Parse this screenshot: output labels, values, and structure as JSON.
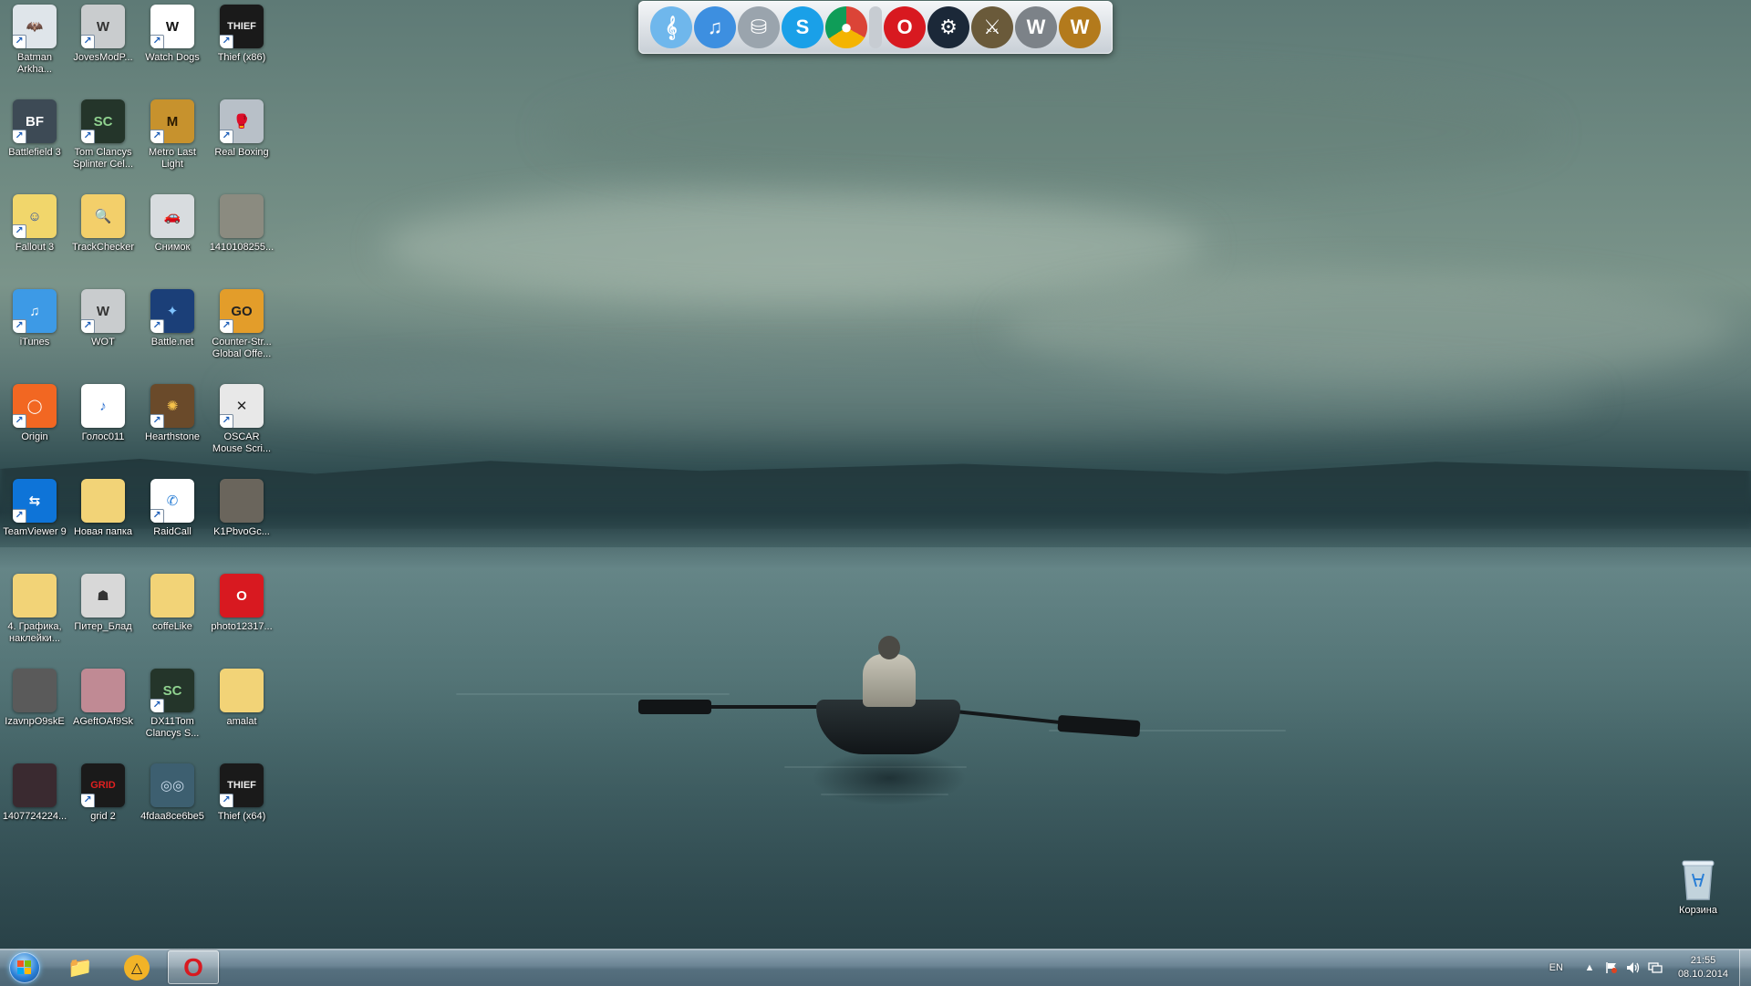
{
  "colors": {
    "taskbar": "#5f7889",
    "dock": "#dde3e8",
    "accent_blue": "#2a7fd6",
    "opera_red": "#d81920",
    "label_text": "#ffffff"
  },
  "desktop_icons": [
    {
      "label": "Batman Arkha...",
      "icon": "batman-icon",
      "bg": "#dfe5ea",
      "fg": "#222",
      "glyph": "🦇",
      "shortcut": true
    },
    {
      "label": "JovesModP...",
      "icon": "wot-shield-icon",
      "bg": "#c9ccce",
      "fg": "#333",
      "glyph": "W",
      "shortcut": true
    },
    {
      "label": "Watch Dogs",
      "icon": "watch-dogs-icon",
      "bg": "#ffffff",
      "fg": "#111",
      "glyph": "W",
      "shortcut": true
    },
    {
      "label": "Thief (x86)",
      "icon": "thief-icon",
      "bg": "#1a1a1a",
      "fg": "#eee",
      "glyph": "THIEF",
      "shortcut": true
    },
    {
      "label": "Battlefield 3",
      "icon": "battlefield-icon",
      "bg": "#3d4a55",
      "fg": "#fff",
      "glyph": "BF",
      "shortcut": true
    },
    {
      "label": "Tom Clancys Splinter Cel...",
      "icon": "splinter-cell-icon",
      "bg": "#24352a",
      "fg": "#8fd18f",
      "glyph": "SC",
      "shortcut": true
    },
    {
      "label": "Metro Last Light",
      "icon": "metro-icon",
      "bg": "#c7922d",
      "fg": "#2a1a00",
      "glyph": "M",
      "shortcut": true
    },
    {
      "label": "Real Boxing",
      "icon": "boxing-icon",
      "bg": "#b8c0c8",
      "fg": "#b21818",
      "glyph": "🥊",
      "shortcut": true
    },
    {
      "label": "Fallout 3",
      "icon": "vault-boy-icon",
      "bg": "#f1d66b",
      "fg": "#2a4fa0",
      "glyph": "☺",
      "shortcut": true
    },
    {
      "label": "TrackChecker",
      "icon": "trackchecker-icon",
      "bg": "#f3cf6a",
      "fg": "#5a4300",
      "glyph": "🔍",
      "shortcut": false
    },
    {
      "label": "Снимок",
      "icon": "image-file-icon",
      "bg": "#d8dcdf",
      "fg": "#222",
      "glyph": "🚗",
      "shortcut": false
    },
    {
      "label": "1410108255...",
      "icon": "image-file-icon",
      "bg": "#8b8b80",
      "fg": "#eee",
      "glyph": "",
      "shortcut": false
    },
    {
      "label": "iTunes",
      "icon": "itunes-icon",
      "bg": "#3d9ae6",
      "fg": "#fff",
      "glyph": "♫",
      "shortcut": true
    },
    {
      "label": "WOT",
      "icon": "wot-shield-icon",
      "bg": "#c9ccce",
      "fg": "#333",
      "glyph": "W",
      "shortcut": true
    },
    {
      "label": "Battle.net",
      "icon": "battlenet-icon",
      "bg": "#1b3f78",
      "fg": "#7fc3ff",
      "glyph": "✦",
      "shortcut": true
    },
    {
      "label": "Counter-Str... Global Offe...",
      "icon": "csgo-icon",
      "bg": "#e39d2a",
      "fg": "#222",
      "glyph": "GO",
      "shortcut": true
    },
    {
      "label": "Origin",
      "icon": "origin-icon",
      "bg": "#f26722",
      "fg": "#fff",
      "glyph": "◯",
      "shortcut": true
    },
    {
      "label": "Голос011",
      "icon": "mp3-file-icon",
      "bg": "#ffffff",
      "fg": "#2a6fd0",
      "glyph": "♪",
      "shortcut": false
    },
    {
      "label": "Hearthstone",
      "icon": "hearthstone-icon",
      "bg": "#6a4a2a",
      "fg": "#f5c24b",
      "glyph": "✺",
      "shortcut": true
    },
    {
      "label": "OSCAR Mouse Scri...",
      "icon": "oscar-icon",
      "bg": "#e8e8e8",
      "fg": "#222",
      "glyph": "✕",
      "shortcut": true
    },
    {
      "label": "TeamViewer 9",
      "icon": "teamviewer-icon",
      "bg": "#0e74d8",
      "fg": "#fff",
      "glyph": "⇆",
      "shortcut": true
    },
    {
      "label": "Новая папка",
      "icon": "folder-icon",
      "bg": "#f2d377",
      "fg": "#7a5d10",
      "glyph": "",
      "shortcut": false
    },
    {
      "label": "RaidCall",
      "icon": "raidcall-icon",
      "bg": "#ffffff",
      "fg": "#2a7fd6",
      "glyph": "✆",
      "shortcut": true
    },
    {
      "label": "K1PbvoGc...",
      "icon": "image-file-icon",
      "bg": "#6a655c",
      "fg": "#eee",
      "glyph": "",
      "shortcut": false
    },
    {
      "label": "4. Графика, наклейки...",
      "icon": "folder-icon",
      "bg": "#f2d377",
      "fg": "#7a5d10",
      "glyph": "",
      "shortcut": false
    },
    {
      "label": "Питер_Блад",
      "icon": "book-file-icon",
      "bg": "#d8d8d8",
      "fg": "#333",
      "glyph": "☗",
      "shortcut": false
    },
    {
      "label": "coffeLike",
      "icon": "folder-icon",
      "bg": "#f2d377",
      "fg": "#7a5d10",
      "glyph": "",
      "shortcut": false
    },
    {
      "label": "photo12317...",
      "icon": "opera-icon",
      "bg": "#d81920",
      "fg": "#fff",
      "glyph": "O",
      "shortcut": false
    },
    {
      "label": "IzavnpO9skE",
      "icon": "image-file-icon",
      "bg": "#5a5a5a",
      "fg": "#ddd",
      "glyph": "",
      "shortcut": false
    },
    {
      "label": "AGeftOAf9Sk",
      "icon": "image-file-icon",
      "bg": "#c08a94",
      "fg": "#fff",
      "glyph": "",
      "shortcut": false
    },
    {
      "label": "DX11Tom Clancys S...",
      "icon": "splinter-cell-icon",
      "bg": "#24352a",
      "fg": "#8fd18f",
      "glyph": "SC",
      "shortcut": true
    },
    {
      "label": "amalat",
      "icon": "folder-icon",
      "bg": "#f2d377",
      "fg": "#7a5d10",
      "glyph": "",
      "shortcut": false
    },
    {
      "label": "1407724224...",
      "icon": "image-file-icon",
      "bg": "#3a2a30",
      "fg": "#d44",
      "glyph": "",
      "shortcut": false
    },
    {
      "label": "grid 2",
      "icon": "grid2-icon",
      "bg": "#1a1a1a",
      "fg": "#e02020",
      "glyph": "GRID",
      "shortcut": true
    },
    {
      "label": "4fdaa8ce6be5",
      "icon": "image-file-icon",
      "bg": "#3d5f70",
      "fg": "#cde",
      "glyph": "◎◎",
      "shortcut": false
    },
    {
      "label": "Thief (x64)",
      "icon": "thief-icon",
      "bg": "#1a1a1a",
      "fg": "#eee",
      "glyph": "THIEF",
      "shortcut": true
    }
  ],
  "dock_items": [
    {
      "name": "music-note-icon",
      "bg": "#6fb7ec",
      "glyph": "𝄞",
      "thin": false
    },
    {
      "name": "itunes-icon",
      "bg": "#3d8fe0",
      "glyph": "♫",
      "thin": false
    },
    {
      "name": "daemon-tools-icon",
      "bg": "#9aa4ad",
      "glyph": "⛁",
      "thin": false
    },
    {
      "name": "skype-icon",
      "bg": "#1aa0e8",
      "glyph": "S",
      "thin": false
    },
    {
      "name": "chrome-icon",
      "bg": "conic-gradient(#db4437 0 33%, #f4b400 0 66%, #0f9d58 0)",
      "glyph": "●",
      "thin": false
    },
    {
      "name": "separator-icon",
      "bg": "#c7ccd2",
      "glyph": "",
      "thin": true
    },
    {
      "name": "opera-icon",
      "bg": "#d81920",
      "glyph": "O",
      "thin": false
    },
    {
      "name": "steam-icon",
      "bg": "#1b2838",
      "glyph": "⚙",
      "thin": false
    },
    {
      "name": "sword-shield-icon",
      "bg": "#6a5a3a",
      "glyph": "⚔",
      "thin": false
    },
    {
      "name": "wot-shield-icon",
      "bg": "#7c8288",
      "glyph": "W",
      "thin": false
    },
    {
      "name": "wow-icon",
      "bg": "#b37a1c",
      "glyph": "W",
      "thin": false
    }
  ],
  "recycle_bin": {
    "label": "Корзина"
  },
  "taskbar": {
    "pinned": [
      {
        "name": "explorer-icon",
        "glyph": "📁",
        "active": false
      },
      {
        "name": "aimp-icon",
        "glyph": "△",
        "active": false
      },
      {
        "name": "opera-icon",
        "glyph": "O",
        "active": true
      }
    ],
    "language": "EN",
    "tray_icons": [
      "show-hidden-icon",
      "action-center-icon",
      "volume-icon",
      "network-icon"
    ],
    "time": "21:55",
    "date": "08.10.2014"
  }
}
